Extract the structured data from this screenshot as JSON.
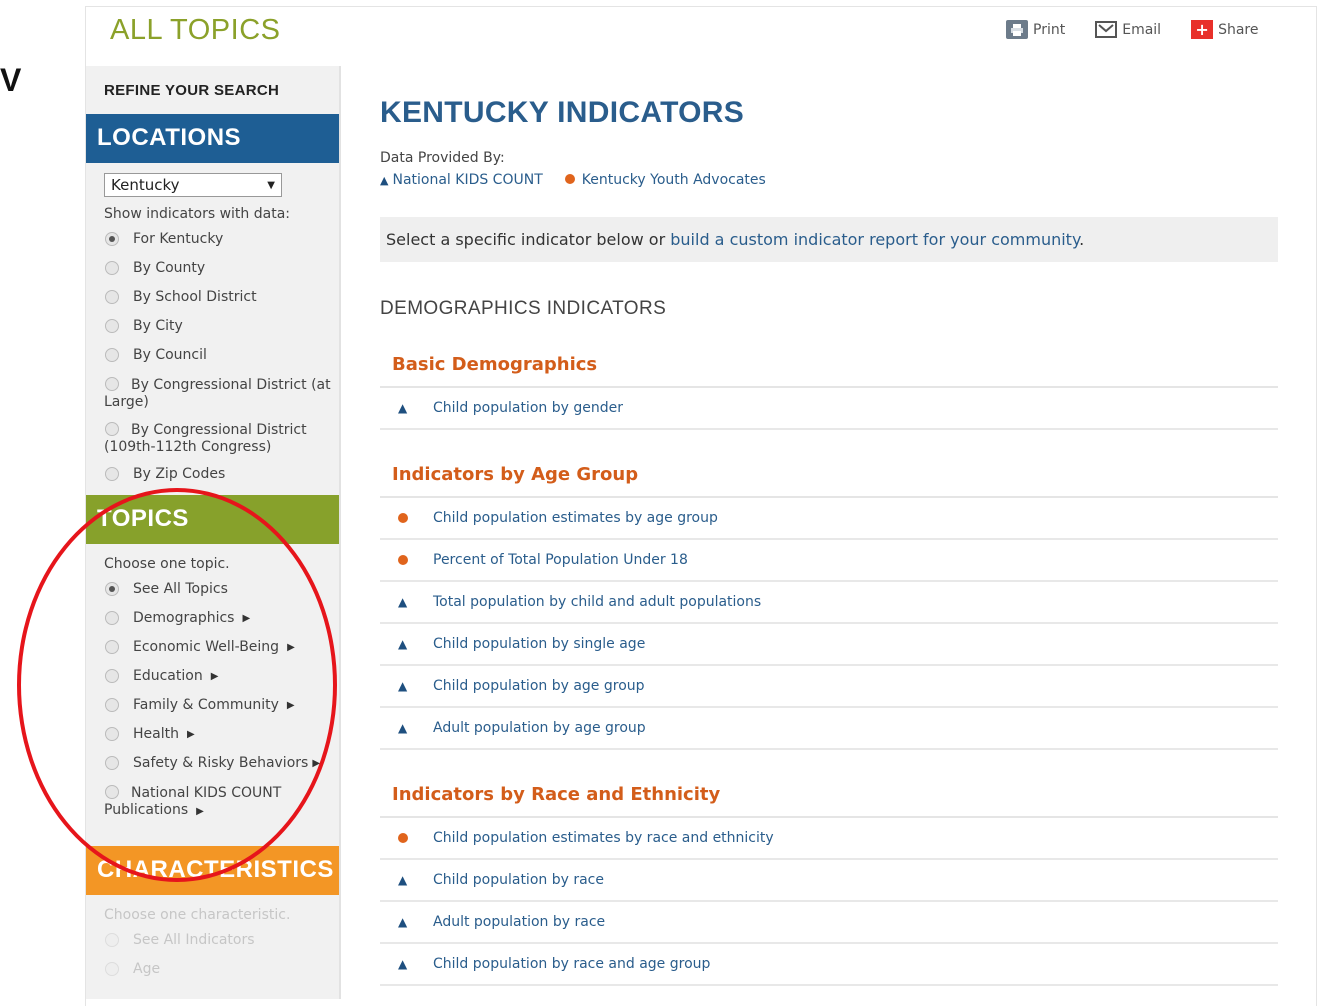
{
  "cut_letter": "V",
  "header": {
    "title": "ALL TOPICS"
  },
  "actions": {
    "print": "Print",
    "email": "Email",
    "share": "Share"
  },
  "sidebar": {
    "refine": "REFINE YOUR SEARCH",
    "locations": {
      "heading": "LOCATIONS",
      "selected": "Kentucky",
      "note": "Show indicators with data:",
      "options": [
        "For Kentucky",
        "By County",
        "By School District",
        "By City",
        "By Council",
        "By Congressional District (at Large)",
        "By Congressional District (109th-112th Congress)",
        "By Zip Codes"
      ]
    },
    "topics": {
      "heading": "TOPICS",
      "note": "Choose one topic.",
      "options": [
        "See All Topics",
        "Demographics",
        "Economic Well-Being",
        "Education",
        "Family & Community",
        "Health",
        "Safety & Risky Behaviors",
        "National KIDS COUNT Publications"
      ]
    },
    "characteristics": {
      "heading": "CHARACTERISTICS",
      "note": "Choose one characteristic.",
      "options": [
        "See All Indicators",
        "Age"
      ]
    }
  },
  "main": {
    "title": "KENTUCKY INDICATORS",
    "provided_by": "Data Provided By:",
    "sources": [
      "National KIDS COUNT",
      "Kentucky Youth Advocates"
    ],
    "banner_prefix": "Select a specific indicator below or ",
    "banner_link": "build a custom indicator report for your community",
    "banner_suffix": ".",
    "section_title": "DEMOGRAPHICS INDICATORS",
    "groups": [
      {
        "title": "Basic Demographics",
        "items": [
          "Child population by gender"
        ]
      },
      {
        "title": "Indicators by Age Group",
        "items": [
          "Child population estimates by age group",
          "Percent of Total Population Under 18",
          "Total population by child and adult populations",
          "Child population by single age",
          "Child population by age group",
          "Adult population by age group"
        ]
      },
      {
        "title": "Indicators by Race and Ethnicity",
        "items": [
          "Child population estimates by race and ethnicity",
          "Child population by race",
          "Adult population by race",
          "Child population by race and age group"
        ]
      }
    ]
  },
  "colors": {
    "locations": "#1e5e94",
    "topics": "#87a12b",
    "characteristics": "#f39625",
    "annotation": "#e6151b"
  }
}
